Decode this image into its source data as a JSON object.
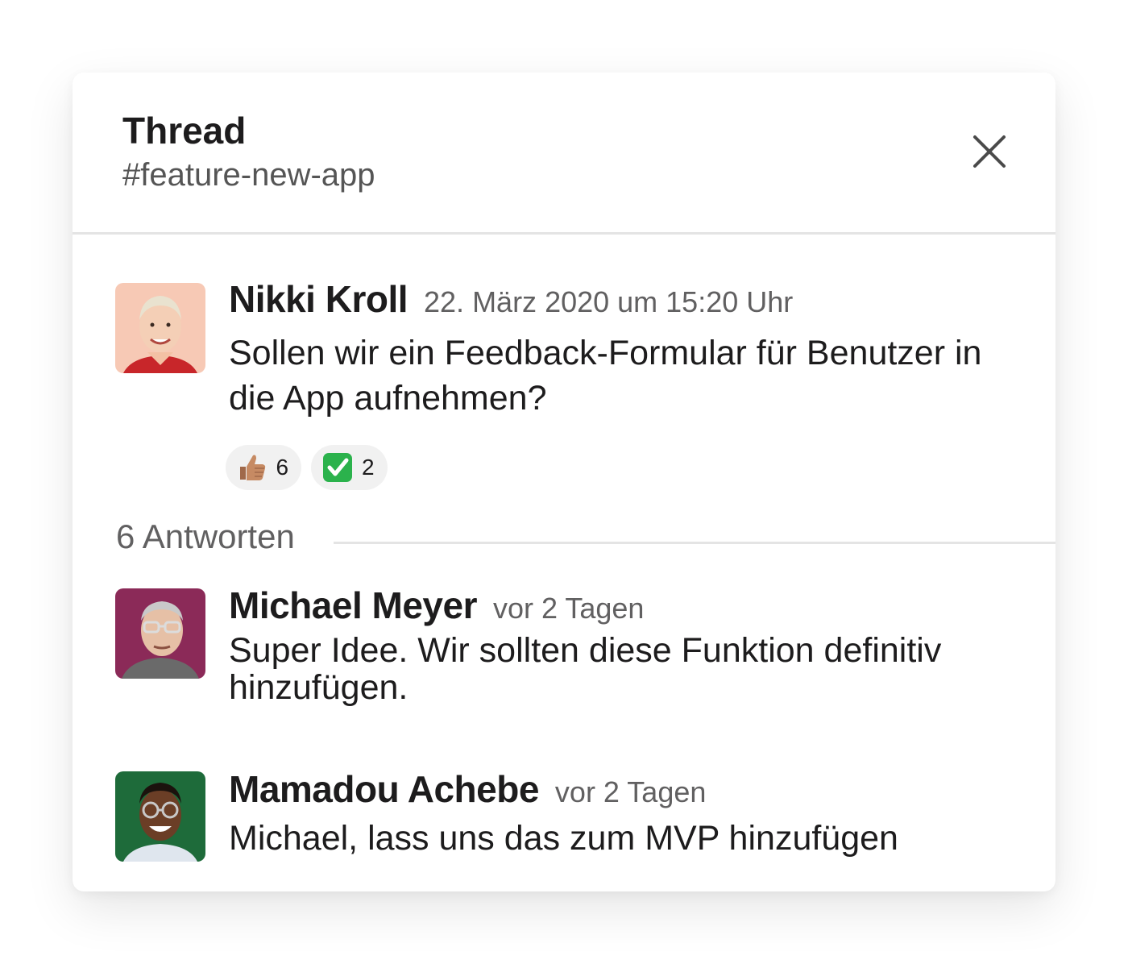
{
  "header": {
    "title": "Thread",
    "channel": "#feature-new-app",
    "close_icon": "close-icon"
  },
  "parent_message": {
    "author": "Nikki Kroll",
    "timestamp": "22. März 2020 um 15:20 Uhr",
    "text": "Sollen wir ein Feedback-Formular für Benutzer in die App aufnehmen?",
    "reactions": [
      {
        "emoji": "thumbs-up-icon",
        "count": "6"
      },
      {
        "emoji": "check-mark-icon",
        "count": "2"
      }
    ]
  },
  "replies": {
    "label": "6 Antworten",
    "items": [
      {
        "author": "Michael Meyer",
        "timestamp": "vor 2 Tagen",
        "text": "Super Idee. Wir sollten diese Funktion definitiv hinzufügen."
      },
      {
        "author": "Mamadou Achebe",
        "timestamp": "vor 2 Tagen",
        "text": "Michael, lass uns das zum MVP hinzufügen"
      }
    ]
  },
  "colors": {
    "accent_check": "#2bb24c",
    "avatar_bg_nikki": "#f7c9b5",
    "avatar_bg_michael": "#8b2a58",
    "avatar_bg_mamadou": "#1e6b3a"
  }
}
